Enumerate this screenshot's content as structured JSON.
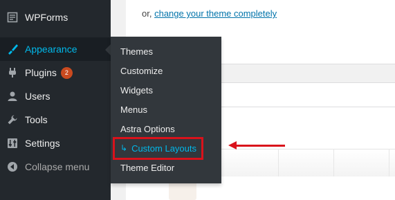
{
  "sidebar": {
    "items": [
      {
        "label": "WPForms",
        "icon": "wpforms-icon"
      },
      {
        "label": "Appearance",
        "icon": "paintbrush-icon",
        "active": true
      },
      {
        "label": "Plugins",
        "icon": "plugin-icon",
        "badge": "2"
      },
      {
        "label": "Users",
        "icon": "user-icon"
      },
      {
        "label": "Tools",
        "icon": "wrench-icon"
      },
      {
        "label": "Settings",
        "icon": "sliders-icon"
      },
      {
        "label": "Collapse menu",
        "icon": "collapse-icon"
      }
    ]
  },
  "submenu": {
    "items": [
      {
        "label": "Themes"
      },
      {
        "label": "Customize"
      },
      {
        "label": "Widgets"
      },
      {
        "label": "Menus"
      },
      {
        "label": "Astra Options"
      },
      {
        "label": "Custom Layouts",
        "prefix": "↳",
        "highlighted": true
      },
      {
        "label": "Theme Editor"
      }
    ]
  },
  "content": {
    "prefix_text": "or,",
    "link_text": "change your theme completely"
  },
  "colors": {
    "sidebar_bg": "#23282d",
    "submenu_bg": "#32373c",
    "accent": "#00b9eb",
    "badge": "#ca4a1f",
    "annotation": "#d9121b",
    "link": "#0073aa"
  }
}
